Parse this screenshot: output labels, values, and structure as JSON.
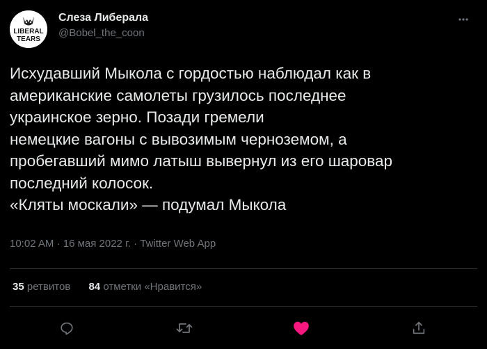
{
  "author": {
    "display_name": "Слеза Либерала",
    "handle": "@Bobel_the_coon",
    "avatar_text_top": "LIBERAL",
    "avatar_text_bottom": "TEARS"
  },
  "tweet": {
    "lines": [
      "Исхудавший Мыкола с гордостью наблюдал как в",
      "американские самолеты грузилось последнее",
      "украинское зерно. Позади гремели",
      "немецкие вагоны с вывозимым черноземом, а",
      "пробегавший мимо латыш вывернул из его шаровар",
      "последний колосок.",
      "«Кляты москали» — подумал Мыкола"
    ],
    "time": "10:02 AM",
    "separator": "·",
    "date": "16 мая 2022 г.",
    "app": "Twitter Web App"
  },
  "stats": {
    "retweets_count": "35",
    "retweets_label": "ретвитов",
    "likes_count": "84",
    "likes_label": "отметки «Нравится»"
  },
  "actions": {
    "reply_icon": "reply-icon",
    "retweet_icon": "retweet-icon",
    "like_icon": "heart-icon",
    "share_icon": "share-icon"
  },
  "colors": {
    "background": "#000000",
    "text": "#e7e9ea",
    "muted": "#71767b",
    "divider": "#2f3336",
    "like": "#f91880"
  }
}
